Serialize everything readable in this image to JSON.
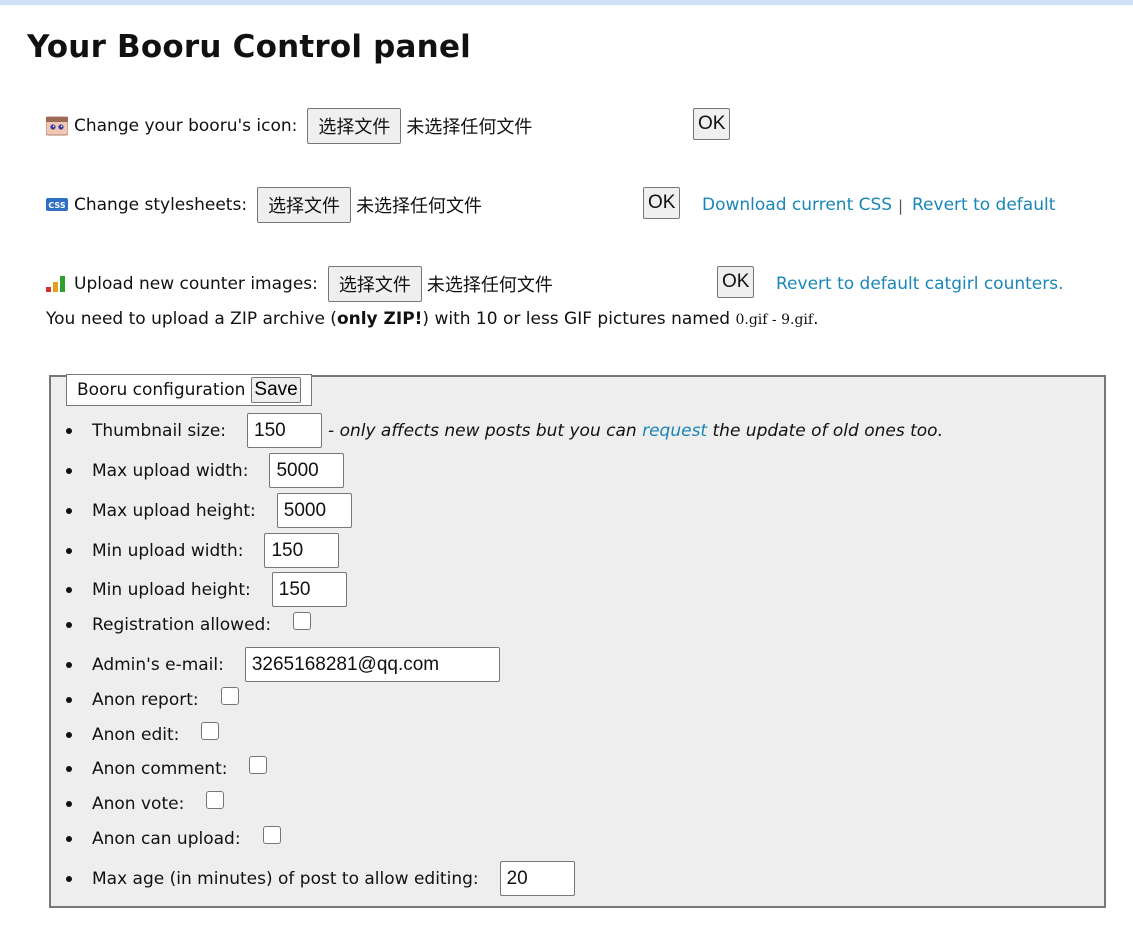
{
  "page": {
    "title": "Your Booru Control panel"
  },
  "file_picker": {
    "button_label": "选择文件",
    "no_file_text": "未选择任何文件"
  },
  "icon_row": {
    "label": "Change your booru's icon:",
    "ok_label": "OK",
    "icon": "booru-face-icon"
  },
  "css_row": {
    "label": "Change stylesheets:",
    "ok_label": "OK",
    "icon": "css-icon",
    "download_link": "Download current CSS",
    "separator": "|",
    "revert_link": "Revert to default"
  },
  "counter_row": {
    "label": "Upload new counter images:",
    "ok_label": "OK",
    "icon": "counter-bars-icon",
    "revert_link": "Revert to default catgirl counters.",
    "note_prefix": "You need to upload a ZIP archive (",
    "note_bold": "only ZIP!",
    "note_mid": ") with 10 or less GIF pictures named ",
    "note_code": "0.gif - 9.gif",
    "note_end": "."
  },
  "config": {
    "legend": "Booru configuration",
    "save_label": "Save",
    "thumbnail": {
      "label": "Thumbnail size:",
      "value": "150",
      "note_pre": "- only affects new posts but you can ",
      "note_link": "request",
      "note_post": " the update of old ones too."
    },
    "max_upload_width": {
      "label": "Max upload width:",
      "value": "5000"
    },
    "max_upload_height": {
      "label": "Max upload height:",
      "value": "5000"
    },
    "min_upload_width": {
      "label": "Min upload width:",
      "value": "150"
    },
    "min_upload_height": {
      "label": "Min upload height:",
      "value": "150"
    },
    "registration_allowed": {
      "label": "Registration allowed:",
      "checked": false
    },
    "admin_email": {
      "label": "Admin's e-mail:",
      "value": "3265168281@qq.com"
    },
    "anon_report": {
      "label": "Anon report:",
      "checked": false
    },
    "anon_edit": {
      "label": "Anon edit:",
      "checked": false
    },
    "anon_comment": {
      "label": "Anon comment:",
      "checked": false
    },
    "anon_vote": {
      "label": "Anon vote:",
      "checked": false
    },
    "anon_upload": {
      "label": "Anon can upload:",
      "checked": false
    },
    "max_age": {
      "label": "Max age (in minutes) of post to allow editing:",
      "value": "20"
    }
  },
  "colors": {
    "link": "#1a86b8",
    "fieldset_bg": "#eeeeee",
    "topbar": "#cfe0f7"
  }
}
